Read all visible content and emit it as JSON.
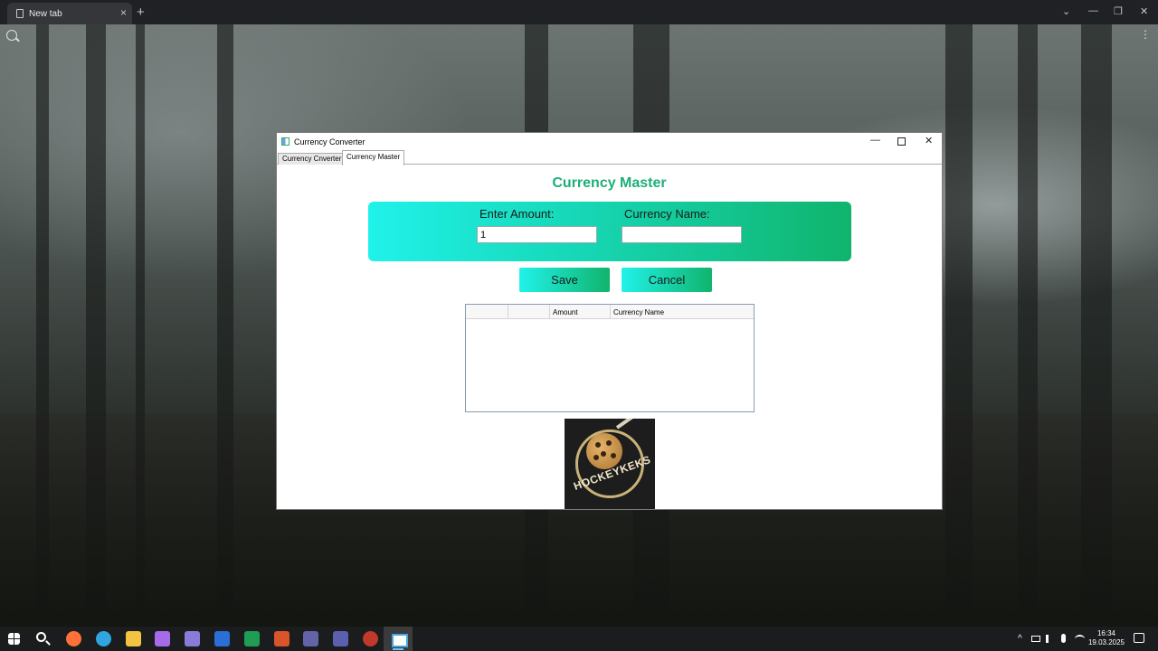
{
  "browser": {
    "tab_title": "New tab",
    "tab_close": "×",
    "new_tab": "+",
    "chevron": "⌄",
    "minimize": "—",
    "restore": "❐",
    "close": "✕",
    "menu": "⋮"
  },
  "app": {
    "window_title": "Currency Converter",
    "title_min": "—",
    "title_close": "✕",
    "tabs": [
      {
        "label": "Currency Cnverter"
      },
      {
        "label": "Currency Master"
      }
    ],
    "heading": "Currency Master",
    "amount_label": "Enter Amount:",
    "amount_value": "1",
    "currency_label": "Currency Name:",
    "currency_value": "",
    "save_label": "Save",
    "cancel_label": "Cancel",
    "grid_columns": [
      "",
      "",
      "Amount",
      "Currency Name"
    ],
    "logo_text": "HOCKEYKEKS"
  },
  "taskbar": {
    "apps": [
      {
        "name": "firefox",
        "color": "#ff7139"
      },
      {
        "name": "edge",
        "color": "#2fa6e0"
      },
      {
        "name": "file-explorer",
        "color": "#f3c342"
      },
      {
        "name": "visual-studio",
        "color": "#a66be8"
      },
      {
        "name": "app-5",
        "color": "#8b7bd8"
      },
      {
        "name": "word",
        "color": "#2b6fd6"
      },
      {
        "name": "excel",
        "color": "#1f9d55"
      },
      {
        "name": "powerpoint",
        "color": "#d9532b"
      },
      {
        "name": "teams",
        "color": "#6264a7"
      },
      {
        "name": "teams-2",
        "color": "#5a5fb0"
      },
      {
        "name": "app-11",
        "color": "#c0392b"
      }
    ],
    "tray_chevron": "^",
    "time": "16:34",
    "date": "19.03.2025"
  }
}
